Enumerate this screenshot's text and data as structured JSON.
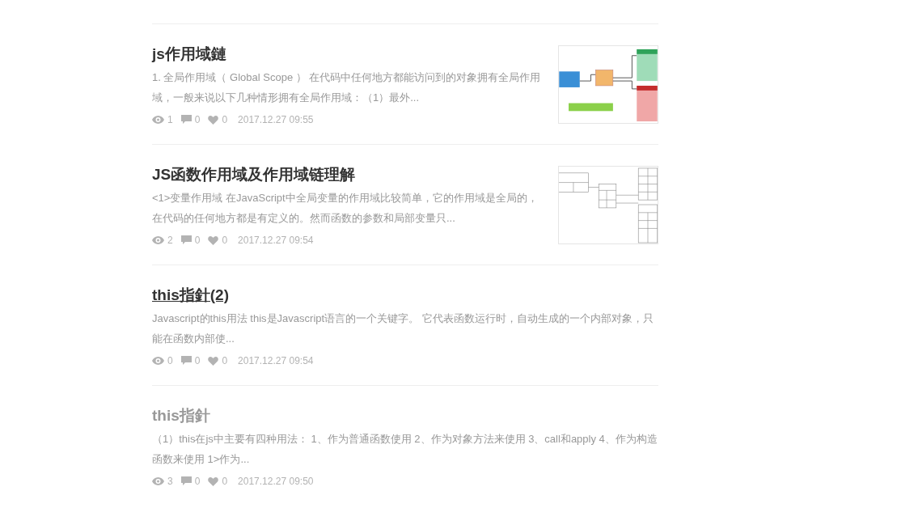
{
  "articles": [
    {
      "title": "js作用域鏈",
      "underlined": false,
      "visited": false,
      "thumbnail": {
        "kind": "colored"
      },
      "excerpt": "1. 全局作用域（ Global Scope ） 在代码中任何地方都能访问到的对象拥有全局作用域，一般来说以下几种情形拥有全局作用域：（1）最外...",
      "views": "1",
      "comments": "0",
      "likes": "0",
      "date": "2017.12.27 09:55"
    },
    {
      "title": "JS函数作用域及作用域链理解",
      "underlined": false,
      "visited": false,
      "thumbnail": {
        "kind": "plain"
      },
      "excerpt": "<1>变量作用域 在JavaScript中全局变量的作用域比较简单，它的作用域是全局的，在代码的任何地方都是有定义的。然而函数的参数和局部变量只...",
      "views": "2",
      "comments": "0",
      "likes": "0",
      "date": "2017.12.27 09:54"
    },
    {
      "title": "this指針(2)",
      "underlined": true,
      "visited": false,
      "excerpt": "Javascript的this用法 this是Javascript语言的一个关键字。 它代表函数运行时，自动生成的一个内部对象，只能在函数内部使...",
      "views": "0",
      "comments": "0",
      "likes": "0",
      "date": "2017.12.27 09:54"
    },
    {
      "title": "this指針",
      "underlined": false,
      "visited": true,
      "excerpt": "（1）this在js中主要有四种用法： 1、作为普通函数使用 2、作为对象方法来使用 3、call和apply 4、作为构造函数来使用 1>作为...",
      "views": "3",
      "comments": "0",
      "likes": "0",
      "date": "2017.12.27 09:50"
    }
  ]
}
